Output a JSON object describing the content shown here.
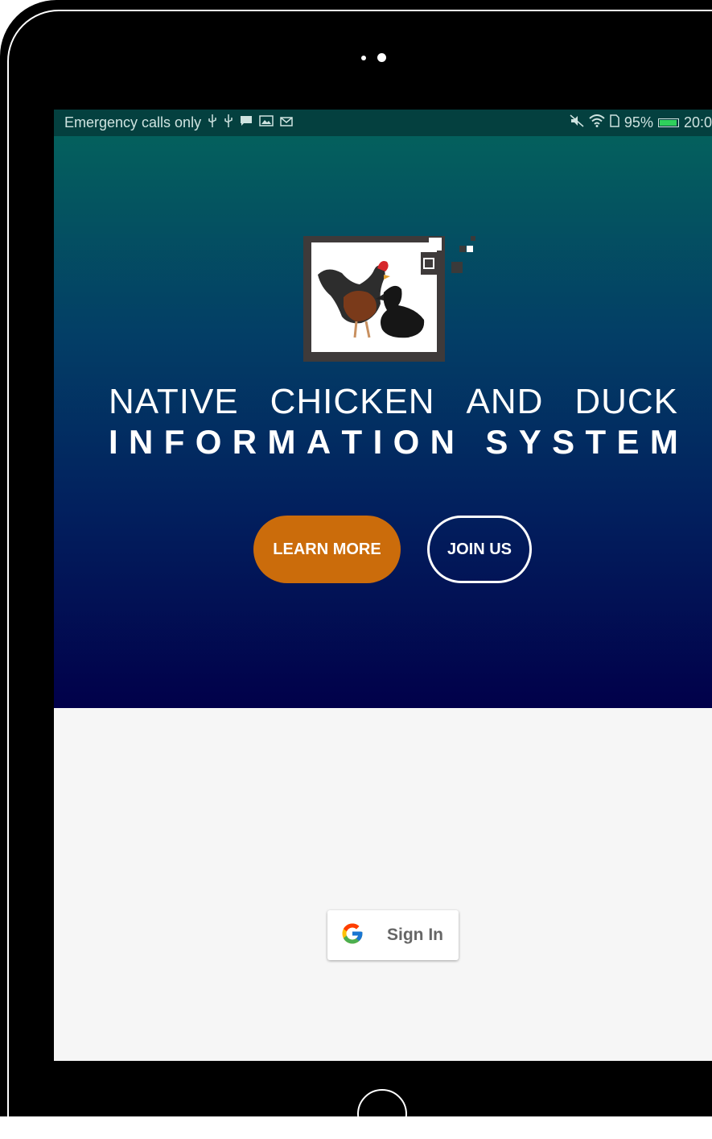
{
  "status_bar": {
    "carrier_text": "Emergency calls only",
    "left_icons": [
      "usb-icon",
      "usb-icon",
      "message-icon",
      "gallery-icon",
      "gmail-icon"
    ],
    "right_icons": [
      "mute-icon",
      "wifi-icon",
      "sim-icon"
    ],
    "battery_percent": "95%",
    "battery_level": 0.95,
    "time": "20:0"
  },
  "hero": {
    "title_line1": [
      "NATIVE",
      "CHICKEN",
      "AND",
      "DUCK"
    ],
    "title_line2": [
      "I",
      "N",
      "F",
      "O",
      "R",
      "M",
      "A",
      "T",
      "I",
      "O",
      "N",
      " ",
      "S",
      "Y",
      "S",
      "T",
      "E",
      "M"
    ],
    "learn_more_label": "LEARN MORE",
    "join_us_label": "JOIN US",
    "colors": {
      "learn_more": "#cb6c0b",
      "gradient_top": "#04605d",
      "gradient_bottom": "#01004a"
    }
  },
  "signin": {
    "label": "Sign In",
    "icon": "google-icon"
  }
}
